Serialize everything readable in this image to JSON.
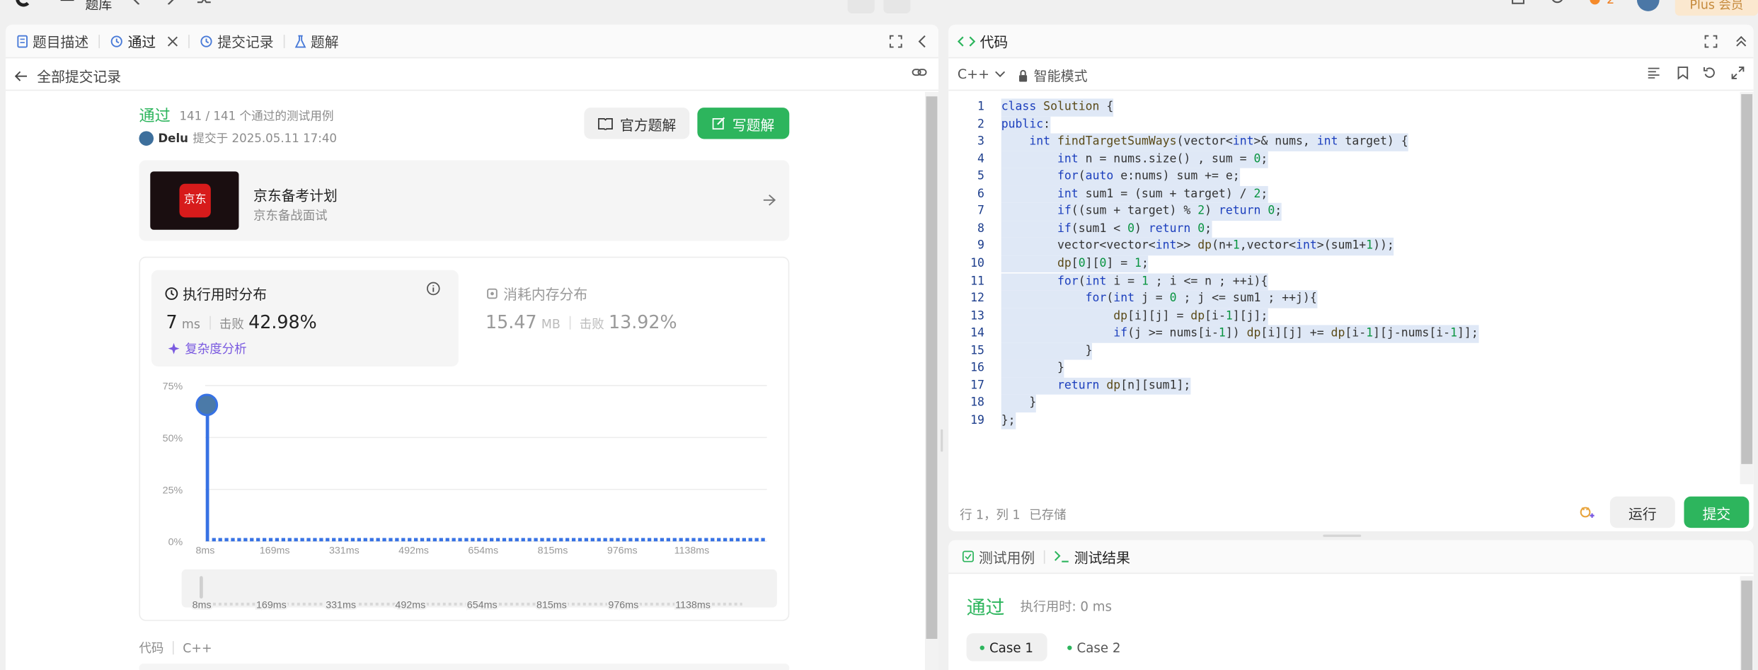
{
  "topnav": {
    "tiku": "题库",
    "count": "2",
    "plus": "Plus 会员"
  },
  "left_tabs": {
    "description": "题目描述",
    "passed": "通过",
    "submissions": "提交记录",
    "solutions": "题解"
  },
  "back_link": "全部提交记录",
  "result": {
    "status": "通过",
    "cases": "141 / 141 个通过的测试用例",
    "user": "Delu",
    "submitted_at": "提交于 2025.05.11 17:40",
    "official_btn": "官方题解",
    "write_btn": "写题解"
  },
  "ad": {
    "logo_text": "京东",
    "title": "京东备考计划",
    "subtitle": "京东备战面试"
  },
  "runtime": {
    "title": "执行用时分布",
    "value": "7",
    "unit": "ms",
    "beats_label": "击败",
    "beats": "42.98%",
    "analysis": "复杂度分析"
  },
  "memory": {
    "title": "消耗内存分布",
    "value": "15.47",
    "unit": "MB",
    "beats_label": "击败",
    "beats": "13.92%"
  },
  "chart_data": {
    "type": "bar",
    "y_ticks": [
      "75%",
      "50%",
      "25%",
      "0%"
    ],
    "x_ticks": [
      "8ms",
      "169ms",
      "331ms",
      "492ms",
      "654ms",
      "815ms",
      "976ms",
      "1138ms"
    ],
    "ylim": [
      0,
      75
    ],
    "values": [
      70,
      1.5,
      1.5,
      1.5,
      1.5,
      1.5,
      1.5,
      1.5,
      1.5,
      1.5,
      1.5,
      1.5,
      1.5,
      1.5,
      1.5,
      1.5,
      1.5,
      1.5,
      1.5,
      1.5,
      1.5,
      1.5,
      1.5,
      1.5,
      1.5,
      1.5,
      1.5,
      1.5,
      1.5,
      1.5,
      1.5,
      1.5,
      1.5,
      1.5,
      1.5,
      1.5,
      1.5,
      1.5,
      1.5,
      1.5,
      1.5,
      1.5,
      1.5,
      1.5,
      1.5,
      1.5,
      1.5,
      1.5,
      1.5,
      1.5,
      1.5,
      1.5,
      1.5,
      1.5,
      1.5,
      1.5,
      1.5,
      1.5,
      1.5,
      1.5,
      1.5,
      1.5,
      1.5,
      1.5,
      1.5,
      1.5,
      1.5,
      1.5,
      1.5,
      1.5,
      1.5,
      1.5,
      1.5,
      1.5,
      1.5,
      1.5,
      1.5,
      1.5,
      1.5,
      1.5,
      1.5,
      1.5,
      1.5,
      1.5,
      1.5,
      1.5,
      1.5,
      1.5,
      1.5
    ],
    "color": "#3772e4",
    "grid": true
  },
  "code_footer": {
    "label": "代码",
    "lang": "C++"
  },
  "editor": {
    "title": "代码",
    "lang": "C++",
    "mode": "智能模式",
    "status_pos": "行 1，列 1",
    "status_saved": "已存储",
    "run": "运行",
    "submit": "提交",
    "lines": [
      "class Solution {",
      "public:",
      "    int findTargetSumWays(vector<int>& nums, int target) {",
      "        int n = nums.size() , sum = 0;",
      "        for(auto e:nums) sum += e;",
      "        int sum1 = (sum + target) / 2;",
      "        if((sum + target) % 2) return 0;",
      "        if(sum1 < 0) return 0;",
      "        vector<vector<int>> dp(n+1,vector<int>(sum1+1));",
      "        dp[0][0] = 1;",
      "        for(int i = 1 ; i <= n ; ++i){",
      "            for(int j = 0 ; j <= sum1 ; ++j){",
      "                dp[i][j] = dp[i-1][j];",
      "                if(j >= nums[i-1]) dp[i][j] += dp[i-1][j-nums[i-1]];",
      "            }",
      "        }",
      "        return dp[n][sum1];",
      "    }",
      "};"
    ]
  },
  "testpanel": {
    "tab_cases": "测试用例",
    "tab_results": "测试结果",
    "status": "通过",
    "runtime": "执行用时: 0 ms",
    "case1": "Case 1",
    "case2": "Case 2"
  }
}
